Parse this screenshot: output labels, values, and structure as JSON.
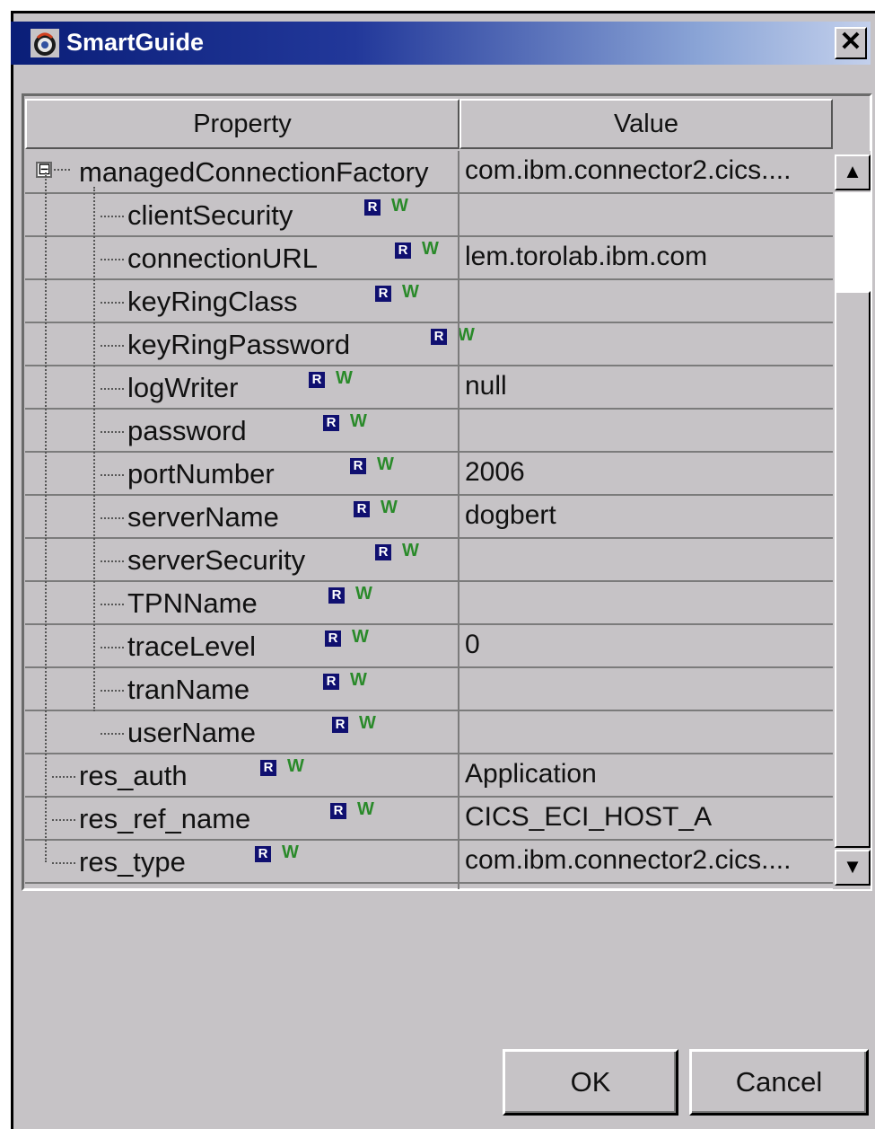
{
  "window": {
    "title": "SmartGuide",
    "close_label": "✕"
  },
  "table": {
    "header": {
      "property": "Property",
      "value": "Value"
    },
    "rows": [
      {
        "property": "managedConnectionFactory",
        "value": "com.ibm.connector2.cics....",
        "level": 0,
        "expander": "⊟",
        "badges": false
      },
      {
        "property": "clientSecurity",
        "value": "",
        "level": 1,
        "badges": true
      },
      {
        "property": "connectionURL",
        "value": "lem.torolab.ibm.com",
        "level": 1,
        "badges": true
      },
      {
        "property": "keyRingClass",
        "value": "",
        "level": 1,
        "badges": true
      },
      {
        "property": "keyRingPassword",
        "value": "",
        "level": 1,
        "badges": true
      },
      {
        "property": "logWriter",
        "value": "null",
        "level": 1,
        "badges": true
      },
      {
        "property": "password",
        "value": "",
        "level": 1,
        "badges": true
      },
      {
        "property": "portNumber",
        "value": "2006",
        "level": 1,
        "badges": true
      },
      {
        "property": "serverName",
        "value": "dogbert",
        "level": 1,
        "badges": true
      },
      {
        "property": "serverSecurity",
        "value": "",
        "level": 1,
        "badges": true
      },
      {
        "property": "TPNName",
        "value": "",
        "level": 1,
        "badges": true
      },
      {
        "property": "traceLevel",
        "value": "0",
        "level": 1,
        "badges": true
      },
      {
        "property": "tranName",
        "value": "",
        "level": 1,
        "badges": true
      },
      {
        "property": "userName",
        "value": "",
        "level": 1,
        "badges": true
      },
      {
        "property": "res_auth",
        "value": "Application",
        "level": 0,
        "badges": true
      },
      {
        "property": "res_ref_name",
        "value": "CICS_ECI_HOST_A",
        "level": 0,
        "badges": true
      },
      {
        "property": "res_type",
        "value": "com.ibm.connector2.cics....",
        "level": 0,
        "badges": true
      }
    ],
    "badge_r": "R",
    "badge_w": "W"
  },
  "buttons": {
    "ok": "OK",
    "cancel": "Cancel"
  },
  "scrollbar": {
    "up": "▲",
    "down": "▼"
  }
}
